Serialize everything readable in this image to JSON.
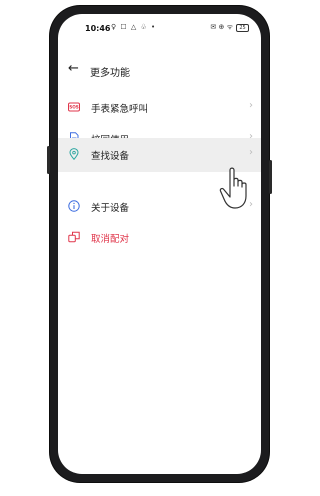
{
  "status_bar": {
    "time": "10:46",
    "notif_icons": "♀ ☐ △ ♧ •",
    "right_icons": "✉ ⊕ ᯤ",
    "battery": "25"
  },
  "header": {
    "title": "更多功能"
  },
  "menu": [
    {
      "label": "手表紧急呼叫",
      "icon": "sos-icon"
    },
    {
      "label": "校园使用",
      "icon": "document-icon"
    },
    {
      "label": "查找设备",
      "icon": "location-pin-icon"
    },
    {
      "label": "关于设备",
      "icon": "info-icon"
    },
    {
      "label": "取消配对",
      "icon": "unpair-icon",
      "color": "#e0364b"
    }
  ],
  "colors": {
    "accent_red": "#e0364b",
    "icon_blue": "#3f6fe0",
    "icon_teal": "#2ba6a0"
  }
}
